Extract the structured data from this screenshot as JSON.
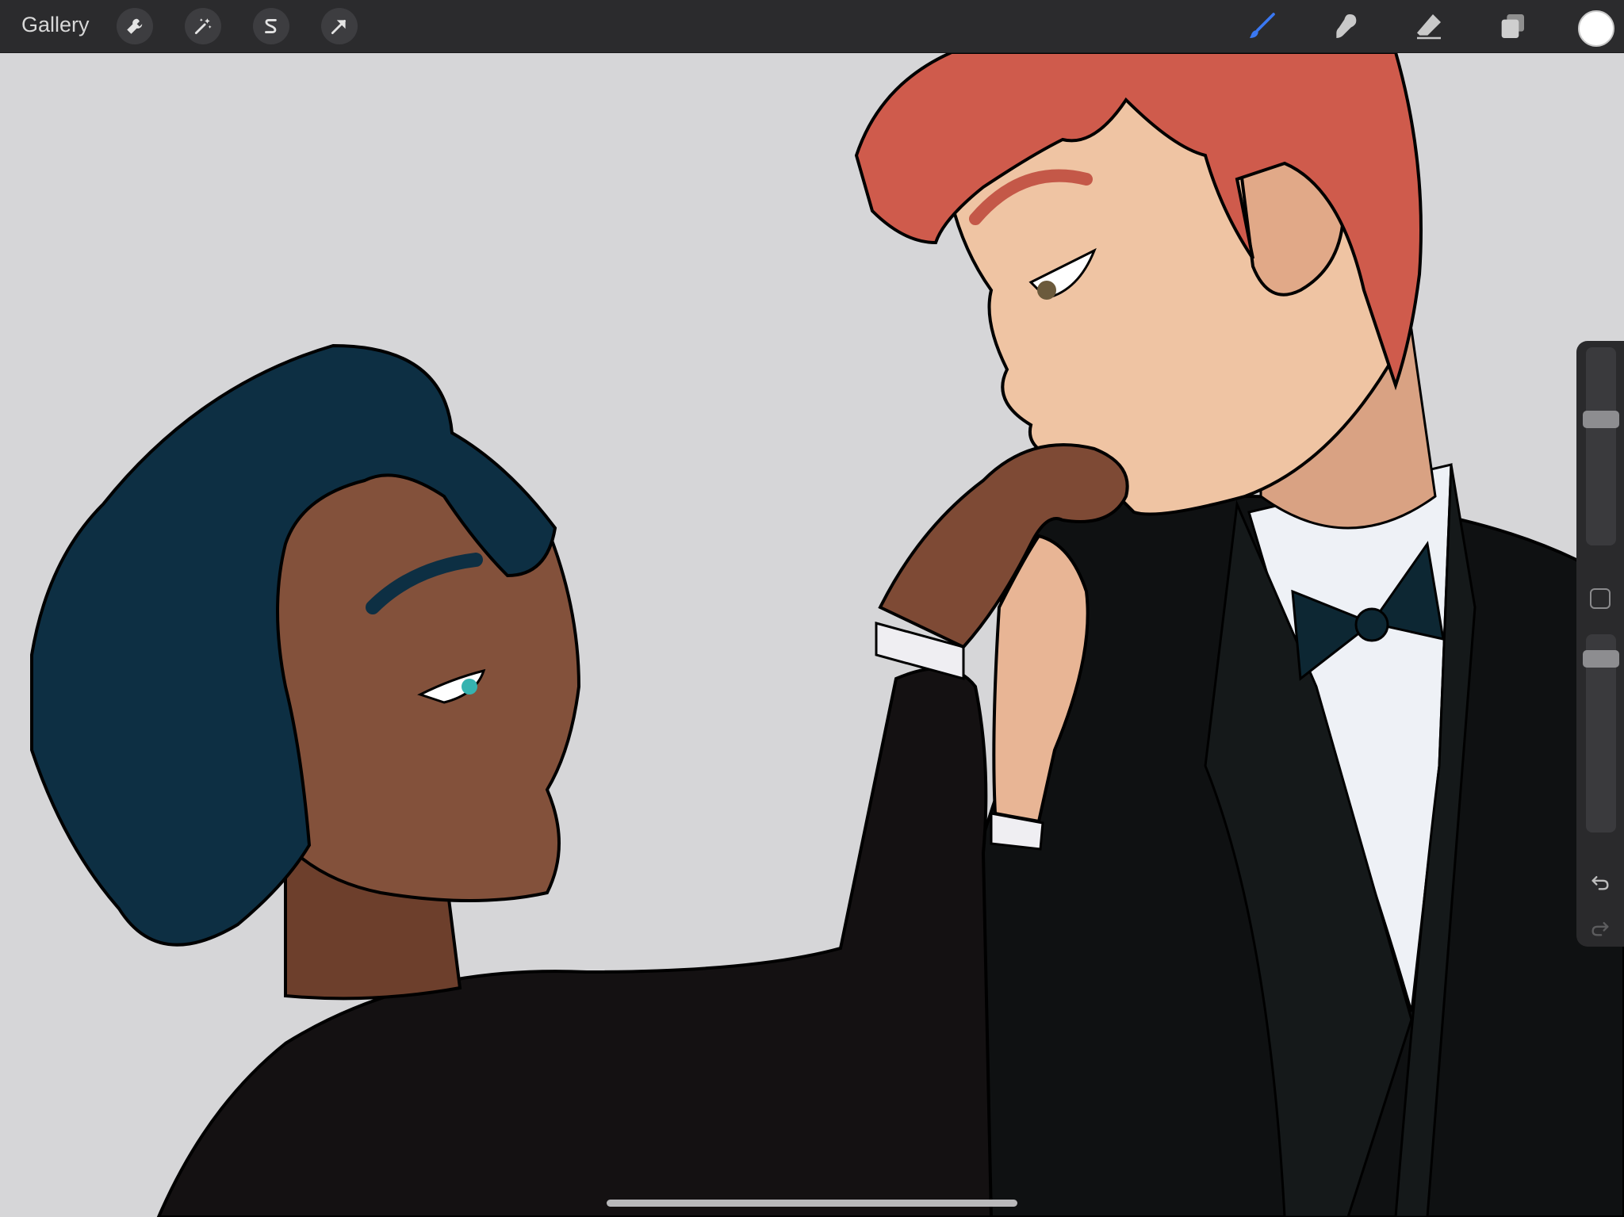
{
  "topbar": {
    "gallery_label": "Gallery",
    "left_tools": [
      {
        "icon": "wrench-icon",
        "name": "actions"
      },
      {
        "icon": "magic-wand-icon",
        "name": "adjustments"
      },
      {
        "icon": "selection-s-icon",
        "name": "selection"
      },
      {
        "icon": "arrow-transform-icon",
        "name": "transform"
      }
    ],
    "right_tools": [
      {
        "icon": "brush-icon",
        "name": "paint",
        "active": true
      },
      {
        "icon": "smudge-icon",
        "name": "smudge"
      },
      {
        "icon": "eraser-icon",
        "name": "erase"
      },
      {
        "icon": "layers-icon",
        "name": "layers"
      }
    ],
    "current_color": "#ffffff"
  },
  "sidebar": {
    "brush_size_level": 0.35,
    "opacity_level": 0.05
  },
  "colors": {
    "accent": "#3a78f2",
    "toolbar_bg": "#2b2b2d",
    "canvas_bg": "#d6d6d8"
  }
}
